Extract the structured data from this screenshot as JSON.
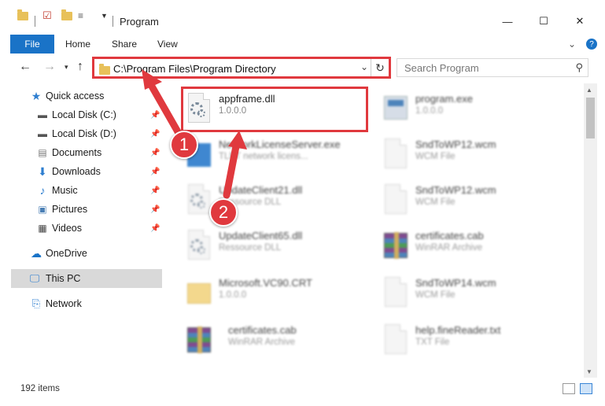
{
  "window": {
    "title": "Program",
    "minimize_glyph": "—",
    "maximize_glyph": "☐",
    "close_glyph": "✕"
  },
  "ribbon": {
    "tabs": [
      "File",
      "Home",
      "Share",
      "View"
    ],
    "expand_glyph": "⌄",
    "help_glyph": "?"
  },
  "address": {
    "path": "C:\\Program Files\\Program Directory",
    "search_placeholder": "Search Program"
  },
  "nav_pane": {
    "items": [
      {
        "label": "Quick access",
        "icon": "star-icon",
        "pinned": false
      },
      {
        "label": "Local Disk (C:)",
        "icon": "drive-icon",
        "pinned": true
      },
      {
        "label": "Local Disk (D:)",
        "icon": "drive-icon",
        "pinned": true
      },
      {
        "label": "Documents",
        "icon": "documents-icon",
        "pinned": true
      },
      {
        "label": "Downloads",
        "icon": "download-icon",
        "pinned": true
      },
      {
        "label": "Music",
        "icon": "music-icon",
        "pinned": true
      },
      {
        "label": "Pictures",
        "icon": "pictures-icon",
        "pinned": true
      },
      {
        "label": "Videos",
        "icon": "videos-icon",
        "pinned": true
      },
      {
        "label": "OneDrive",
        "icon": "cloud-icon",
        "pinned": false
      },
      {
        "label": "This PC",
        "icon": "computer-icon",
        "pinned": false,
        "selected": true
      },
      {
        "label": "Network",
        "icon": "network-icon",
        "pinned": false
      }
    ]
  },
  "files": [
    {
      "name": "appframe.dll",
      "type": "1.0.0.0",
      "icon": "dll-gear-icon",
      "highlighted": true
    },
    {
      "name": "program.exe",
      "type": "1.0.0.0",
      "icon": "exe-app-icon"
    },
    {
      "name": "NetworkLicenseServer.exe",
      "type": "TLET network licens...",
      "icon": "exe-blue-icon"
    },
    {
      "name": "SndToWP12.wcm",
      "type": "WCM File",
      "icon": "blank-file-icon"
    },
    {
      "name": "UpdateClient21.dll",
      "type": "Ressource DLL",
      "icon": "dll-gear-icon"
    },
    {
      "name": "SndToWP12.wcm",
      "type": "WCM File",
      "icon": "blank-file-icon"
    },
    {
      "name": "UpdateClient65.dll",
      "type": "Ressource DLL",
      "icon": "dll-gear-icon"
    },
    {
      "name": "certificates.cab",
      "type": "WinRAR Archive",
      "icon": "winrar-icon"
    },
    {
      "name": "Microsoft.VC90.CRT",
      "type": "1.0.0.0",
      "icon": "folder-file-icon"
    },
    {
      "name": "SndToWP14.wcm",
      "type": "WCM File",
      "icon": "blank-file-icon"
    },
    {
      "name": "certificates.cab",
      "type": "WinRAR Archive",
      "icon": "winrar-icon"
    },
    {
      "name": "help.fineReader.txt",
      "type": "TXT File",
      "icon": "blank-file-icon"
    }
  ],
  "status": {
    "item_count": "192 items"
  },
  "annotations": {
    "step1": "1",
    "step2": "2"
  },
  "colors": {
    "accent": "#1a73c7",
    "highlight_red": "#e0393e",
    "selected_bg": "#d9d9d9"
  }
}
